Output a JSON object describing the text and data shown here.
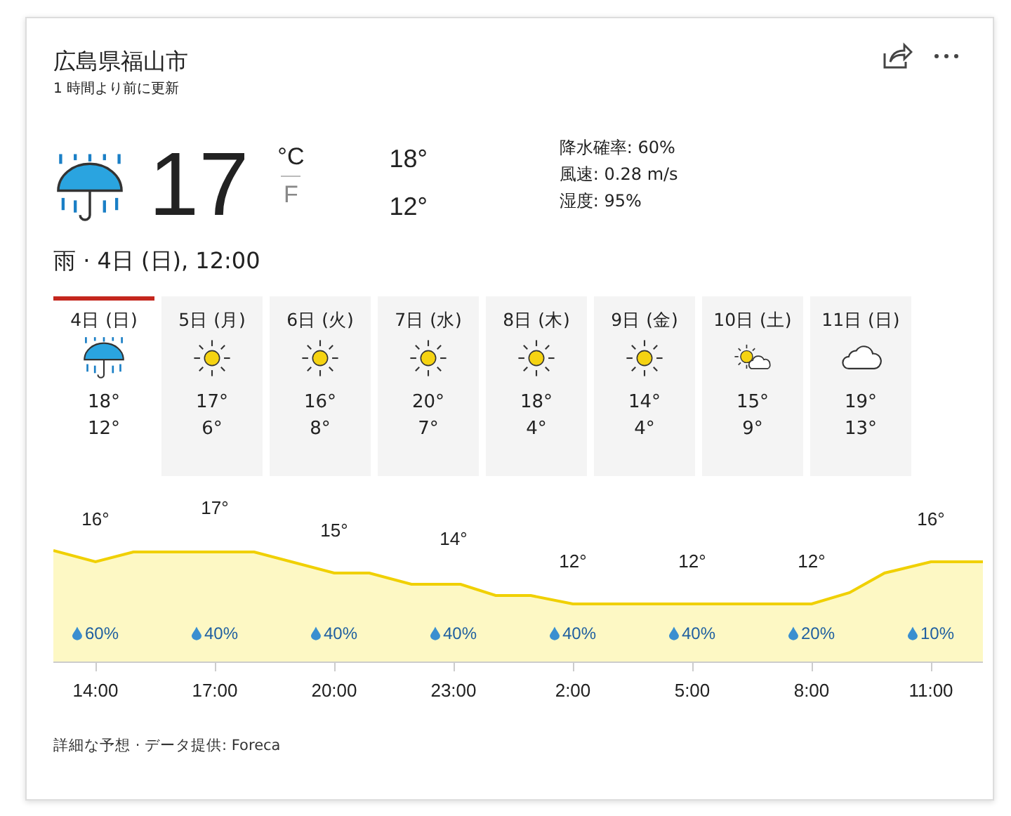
{
  "location": {
    "title": "広島県福山市",
    "updated": "1 時間より前に更新"
  },
  "current": {
    "kind": "rain",
    "temp": "17",
    "units": [
      {
        "label": "°C",
        "selected": true
      },
      {
        "label": "F",
        "selected": false
      }
    ],
    "high": "18°",
    "low": "12°",
    "details": [
      "降水確率: 60%",
      "風速: 0.28 m/s",
      "湿度: 95%"
    ],
    "summary": "雨 · 4日 (日), 12:00"
  },
  "days": [
    {
      "label": "4日 (日)",
      "kind": "rain",
      "high": "18°",
      "low": "12°",
      "selected": true
    },
    {
      "label": "5日 (月)",
      "kind": "sunny",
      "high": "17°",
      "low": "6°",
      "selected": false
    },
    {
      "label": "6日 (火)",
      "kind": "sunny",
      "high": "16°",
      "low": "8°",
      "selected": false
    },
    {
      "label": "7日 (水)",
      "kind": "sunny",
      "high": "20°",
      "low": "7°",
      "selected": false
    },
    {
      "label": "8日 (木)",
      "kind": "sunny",
      "high": "18°",
      "low": "4°",
      "selected": false
    },
    {
      "label": "9日 (金)",
      "kind": "sunny",
      "high": "14°",
      "low": "4°",
      "selected": false
    },
    {
      "label": "10日 (土)",
      "kind": "partly-cloudy",
      "high": "15°",
      "low": "9°",
      "selected": false
    },
    {
      "label": "11日 (日)",
      "kind": "cloudy",
      "high": "19°",
      "low": "13°",
      "selected": false
    }
  ],
  "hourly": [
    {
      "temp": "16°",
      "precip": "60%",
      "time": "14:00"
    },
    {
      "temp": "17°",
      "precip": "40%",
      "time": "17:00"
    },
    {
      "temp": "15°",
      "precip": "40%",
      "time": "20:00"
    },
    {
      "temp": "14°",
      "precip": "40%",
      "time": "23:00"
    },
    {
      "temp": "12°",
      "precip": "40%",
      "time": "2:00"
    },
    {
      "temp": "12°",
      "precip": "40%",
      "time": "5:00"
    },
    {
      "temp": "12°",
      "precip": "20%",
      "time": "8:00"
    },
    {
      "temp": "16°",
      "precip": "10%",
      "time": "11:00"
    }
  ],
  "footer": "詳細な予想 · データ提供: Foreca"
}
